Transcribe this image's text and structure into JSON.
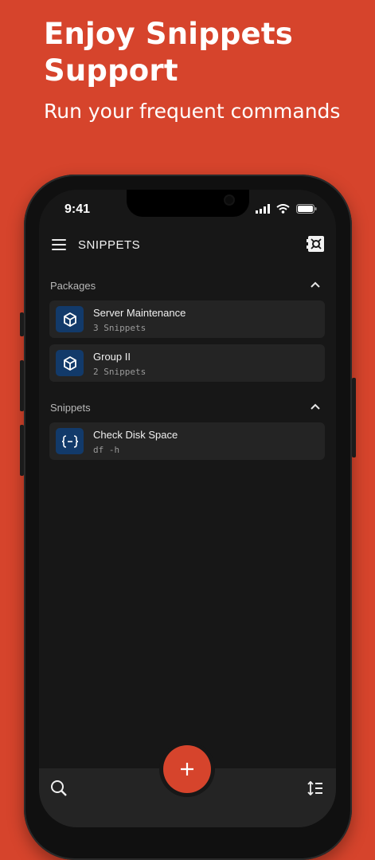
{
  "promo": {
    "title": "Enjoy Snippets Support",
    "subtitle": "Run your frequent commands"
  },
  "status_bar": {
    "time": "9:41"
  },
  "app_bar": {
    "title": "SNIPPETS",
    "menu_icon": "hamburger-menu-icon",
    "action_icon": "vault-icon"
  },
  "packages": {
    "header": "Packages",
    "items": [
      {
        "name": "Server Maintenance",
        "detail": "3 Snippets",
        "icon": "package-cube-icon"
      },
      {
        "name": "Group II",
        "detail": "2 Snippets",
        "icon": "package-cube-icon"
      }
    ]
  },
  "snippets": {
    "header": "Snippets",
    "items": [
      {
        "name": "Check Disk Space",
        "detail": "df -h",
        "icon": "snippet-braces-icon"
      }
    ]
  },
  "bottom_bar": {
    "left_icon": "search-icon",
    "center_icon": "plus-icon",
    "right_icon": "sort-icon"
  },
  "colors": {
    "brand": "#d6442c",
    "icon_badge": "#123a6a",
    "card": "#242424",
    "screen": "#171717"
  }
}
